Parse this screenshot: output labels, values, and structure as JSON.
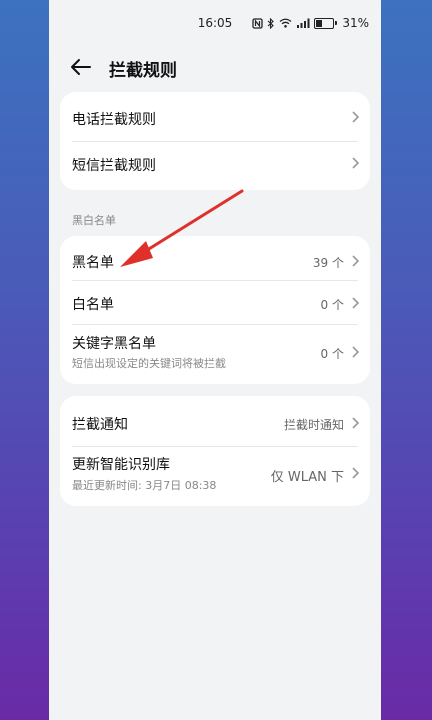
{
  "status_bar": {
    "time": "16:05",
    "battery_percent": "31%"
  },
  "header": {
    "title": "拦截规则"
  },
  "card1": {
    "items": [
      {
        "label": "电话拦截规则"
      },
      {
        "label": "短信拦截规则"
      }
    ]
  },
  "section": {
    "title": "黑白名单"
  },
  "card2": {
    "items": [
      {
        "label": "黑名单",
        "value": "39 个"
      },
      {
        "label": "白名单",
        "value": "0 个"
      },
      {
        "label": "关键字黑名单",
        "subtitle": "短信出现设定的关键词将被拦截",
        "value": "0 个"
      }
    ]
  },
  "card3": {
    "items": [
      {
        "label": "拦截通知",
        "value": "拦截时通知"
      },
      {
        "label": "更新智能识别库",
        "subtitle": "最近更新时间: 3月7日 08:38",
        "value": "仅 WLAN 下"
      }
    ]
  },
  "colors": {
    "accent_arrow": "#e0302a",
    "phone_bg": "#f1f3f5"
  },
  "icons": [
    "back-arrow-icon",
    "chevron-right-icon",
    "battery-icon",
    "wifi-icon",
    "signal-icon",
    "bluetooth-icon",
    "nfc-icon"
  ]
}
